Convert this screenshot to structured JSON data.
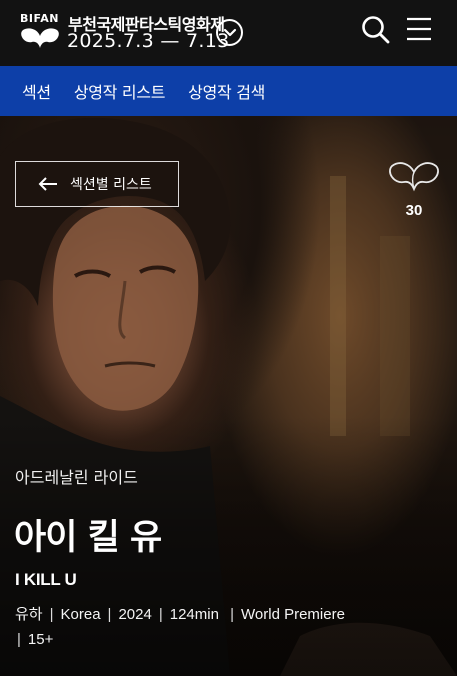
{
  "header": {
    "logo_text": "BIFAN",
    "festival_name": "부천국제판타스틱영화제",
    "festival_dates": "2025.7.3 — 7.13"
  },
  "nav": {
    "items": [
      {
        "label": "섹션"
      },
      {
        "label": "상영작 리스트"
      },
      {
        "label": "상영작 검색"
      }
    ]
  },
  "hero": {
    "back_button_label": "섹션별 리스트",
    "like_count": "30",
    "section_name": "아드레날린 라이드",
    "title_korean": "아이 킬 유",
    "title_english": "I KILL U",
    "meta": {
      "director": "유하",
      "country": "Korea",
      "year": "2024",
      "runtime": "124min",
      "premiere": "World Premiere",
      "rating": "15+"
    }
  },
  "colors": {
    "topbar": "#121212",
    "navbar": "#0d3fa8",
    "text": "#ffffff"
  }
}
